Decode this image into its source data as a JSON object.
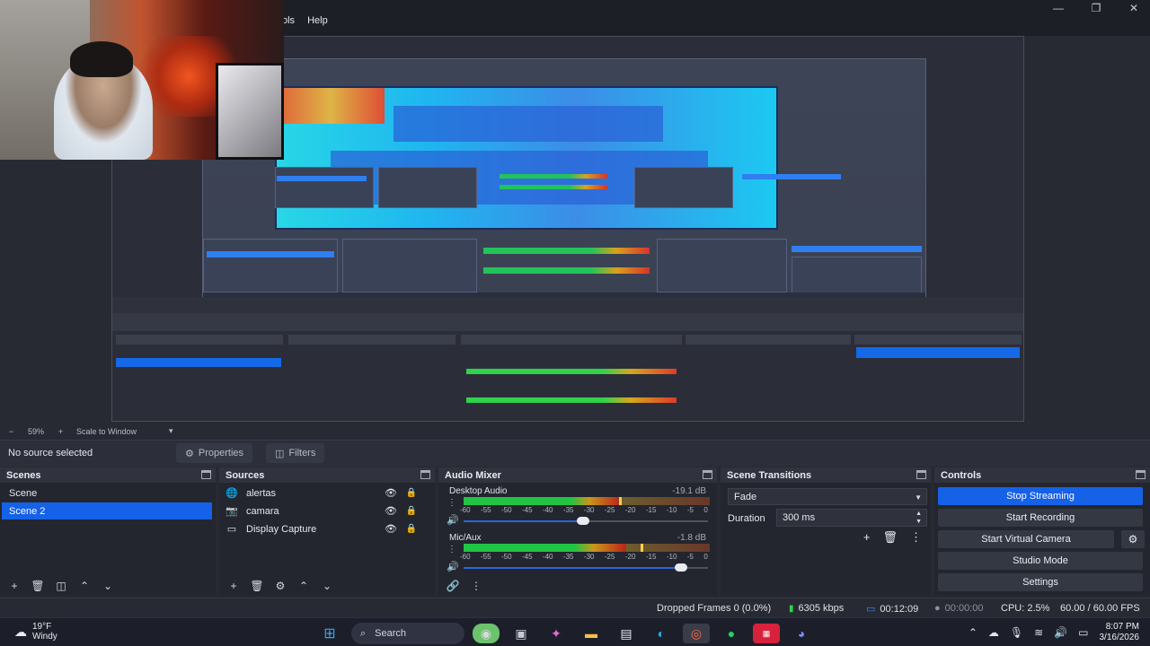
{
  "menu": {
    "items": [
      "ols",
      "Help"
    ]
  },
  "window_controls": [
    "—",
    "❐",
    "✕"
  ],
  "zoom": {
    "level": "59%",
    "scale_mode": "Scale to Window"
  },
  "properties_bar": {
    "no_source": "No source selected",
    "properties_label": "Properties",
    "filters_label": "Filters"
  },
  "scenes": {
    "title": "Scenes",
    "items": [
      "Scene",
      "Scene 2"
    ],
    "selected_index": 1
  },
  "sources": {
    "title": "Sources",
    "items": [
      {
        "name": "alertas",
        "icon": "globe-icon"
      },
      {
        "name": "camara",
        "icon": "camera-icon"
      },
      {
        "name": "Display Capture",
        "icon": "monitor-icon"
      }
    ]
  },
  "mixer": {
    "title": "Audio Mixer",
    "channels": [
      {
        "name": "Desktop Audio",
        "db": "-19.1 dB",
        "level": 0.64,
        "peak": 0.63,
        "volume": 0.49
      },
      {
        "name": "Mic/Aux",
        "db": "-1.8 dB",
        "level": 0.66,
        "peak": 0.72,
        "volume": 0.89
      }
    ],
    "ticks": [
      "-60",
      "-55",
      "-50",
      "-45",
      "-40",
      "-35",
      "-30",
      "-25",
      "-20",
      "-15",
      "-10",
      "-5",
      "0"
    ]
  },
  "transitions": {
    "title": "Scene Transitions",
    "selected": "Fade",
    "duration_label": "Duration",
    "duration_value": "300 ms"
  },
  "controls": {
    "title": "Controls",
    "buttons": [
      "Stop Streaming",
      "Start Recording",
      "Start Virtual Camera",
      "Studio Mode",
      "Settings"
    ]
  },
  "status": {
    "dropped": "Dropped Frames 0 (0.0%)",
    "bitrate": "6305 kbps",
    "stream_time": "00:12:09",
    "rec_time": "00:00:00",
    "cpu": "CPU: 2.5%",
    "fps": "60.00 / 60.00 FPS"
  },
  "taskbar": {
    "weather_temp": "19°F",
    "weather_desc": "Windy",
    "search_label": "Search",
    "time": "8:07 PM",
    "date": "3/16/2026"
  },
  "colors": {
    "accent": "#1561e8",
    "meter_green": "#20c543",
    "meter_yellow": "#c9971a",
    "meter_red": "#b9231c"
  }
}
